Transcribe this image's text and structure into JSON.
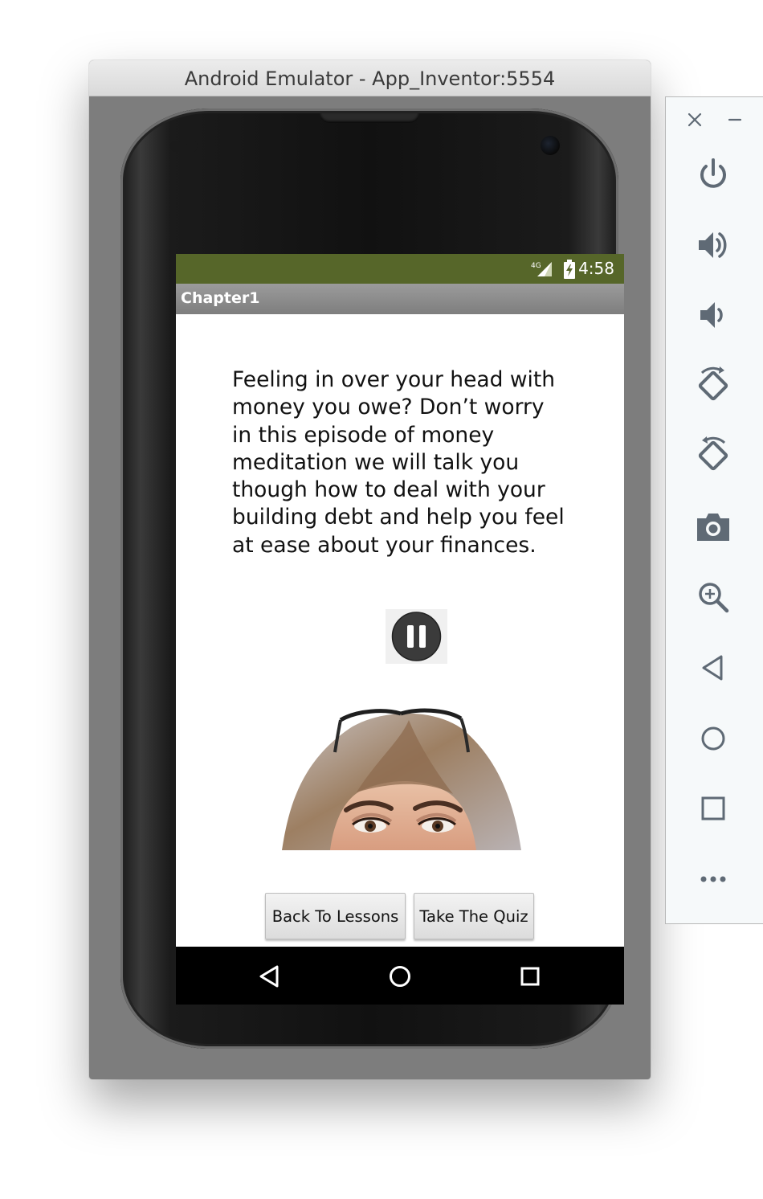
{
  "window": {
    "title": "Android Emulator - App_Inventor:5554"
  },
  "status_bar": {
    "network": "4G",
    "time": "4:58"
  },
  "action_bar": {
    "title": "Chapter1"
  },
  "content": {
    "description": "Feeling in over your head with money you owe? Don’t worry in this episode of money meditation we will talk you though how to deal with your building debt and help you feel at ease about your finances.",
    "media_control": "pause-icon",
    "image": "woman-eyes-glasses-photo"
  },
  "buttons": {
    "back_to_lessons": "Back To Lessons",
    "take_the_quiz": "Take The Quiz"
  },
  "nav_bar": [
    "back-icon",
    "home-icon",
    "recents-icon"
  ],
  "side_toolbar": {
    "window_controls": [
      "close-icon",
      "minimize-icon"
    ],
    "items": [
      "power-icon",
      "volume-up-icon",
      "volume-down-icon",
      "rotate-left-icon",
      "rotate-right-icon",
      "camera-icon",
      "zoom-icon",
      "back-icon",
      "home-icon",
      "overview-icon",
      "more-icon"
    ]
  },
  "colors": {
    "status_bar": "#566629",
    "action_bar": "#8a8a8a",
    "toolbar_icon": "#5f6a75"
  }
}
